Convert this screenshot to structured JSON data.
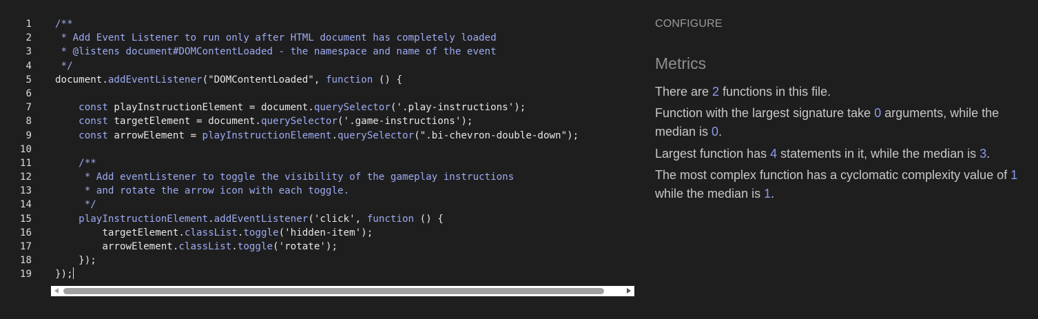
{
  "editor": {
    "lines": [
      {
        "n": "1",
        "tokens": [
          {
            "t": "/**",
            "c": "comment"
          }
        ]
      },
      {
        "n": "2",
        "tokens": [
          {
            "t": " * Add Event Listener to run only after HTML document has completely loaded",
            "c": "comment"
          }
        ]
      },
      {
        "n": "3",
        "tokens": [
          {
            "t": " * @listens document#DOMContentLoaded - the namespace and name of the event",
            "c": "comment"
          }
        ]
      },
      {
        "n": "4",
        "tokens": [
          {
            "t": " */",
            "c": "comment"
          }
        ]
      },
      {
        "n": "5",
        "tokens": [
          {
            "t": "document",
            "c": "plain"
          },
          {
            "t": ".",
            "c": "plain"
          },
          {
            "t": "addEventListener",
            "c": "prop"
          },
          {
            "t": "(\"DOMContentLoaded\", ",
            "c": "string"
          },
          {
            "t": "function",
            "c": "keyword"
          },
          {
            "t": " () {",
            "c": "plain"
          }
        ]
      },
      {
        "n": "6",
        "tokens": []
      },
      {
        "n": "7",
        "tokens": [
          {
            "t": "    const ",
            "c": "keyword"
          },
          {
            "t": "playInstructionElement = document.",
            "c": "plain"
          },
          {
            "t": "querySelector",
            "c": "prop"
          },
          {
            "t": "('.play-instructions');",
            "c": "string"
          }
        ]
      },
      {
        "n": "8",
        "tokens": [
          {
            "t": "    const ",
            "c": "keyword"
          },
          {
            "t": "targetElement = document.",
            "c": "plain"
          },
          {
            "t": "querySelector",
            "c": "prop"
          },
          {
            "t": "('.game-instructions');",
            "c": "string"
          }
        ]
      },
      {
        "n": "9",
        "tokens": [
          {
            "t": "    const ",
            "c": "keyword"
          },
          {
            "t": "arrowElement = ",
            "c": "plain"
          },
          {
            "t": "playInstructionElement",
            "c": "prop"
          },
          {
            "t": ".",
            "c": "plain"
          },
          {
            "t": "querySelector",
            "c": "prop"
          },
          {
            "t": "(\".bi-chevron-double-down\");",
            "c": "string"
          }
        ]
      },
      {
        "n": "10",
        "tokens": []
      },
      {
        "n": "11",
        "tokens": [
          {
            "t": "    /**",
            "c": "comment"
          }
        ]
      },
      {
        "n": "12",
        "tokens": [
          {
            "t": "     * Add eventListener to toggle the visibility of the gameplay instructions",
            "c": "comment"
          }
        ]
      },
      {
        "n": "13",
        "tokens": [
          {
            "t": "     * and rotate the arrow icon with each toggle.",
            "c": "comment"
          }
        ]
      },
      {
        "n": "14",
        "tokens": [
          {
            "t": "     */",
            "c": "comment"
          }
        ]
      },
      {
        "n": "15",
        "tokens": [
          {
            "t": "    playInstructionElement",
            "c": "prop"
          },
          {
            "t": ".",
            "c": "plain"
          },
          {
            "t": "addEventListener",
            "c": "prop"
          },
          {
            "t": "('click', ",
            "c": "string"
          },
          {
            "t": "function",
            "c": "keyword"
          },
          {
            "t": " () {",
            "c": "plain"
          }
        ]
      },
      {
        "n": "16",
        "tokens": [
          {
            "t": "        targetElement.",
            "c": "plain"
          },
          {
            "t": "classList",
            "c": "prop"
          },
          {
            "t": ".",
            "c": "plain"
          },
          {
            "t": "toggle",
            "c": "prop"
          },
          {
            "t": "('hidden-item');",
            "c": "string"
          }
        ]
      },
      {
        "n": "17",
        "tokens": [
          {
            "t": "        arrowElement.",
            "c": "plain"
          },
          {
            "t": "classList",
            "c": "prop"
          },
          {
            "t": ".",
            "c": "plain"
          },
          {
            "t": "toggle",
            "c": "prop"
          },
          {
            "t": "('rotate');",
            "c": "string"
          }
        ]
      },
      {
        "n": "18",
        "tokens": [
          {
            "t": "    });",
            "c": "plain"
          }
        ]
      },
      {
        "n": "19",
        "tokens": [
          {
            "t": "});",
            "c": "plain"
          }
        ],
        "caret": true
      }
    ]
  },
  "panel": {
    "configure_label": "CONFIGURE",
    "metrics_title": "Metrics",
    "metrics": [
      {
        "segments": [
          {
            "t": "There are "
          },
          {
            "t": "2",
            "num": true
          },
          {
            "t": " functions in this file."
          }
        ]
      },
      {
        "segments": [
          {
            "t": "Function with the largest signature take "
          },
          {
            "t": "0",
            "num": true
          },
          {
            "t": " arguments, while the median is "
          },
          {
            "t": "0",
            "num": true
          },
          {
            "t": "."
          }
        ]
      },
      {
        "segments": [
          {
            "t": "Largest function has "
          },
          {
            "t": "4",
            "num": true
          },
          {
            "t": " statements in it, while the median is "
          },
          {
            "t": "3",
            "num": true
          },
          {
            "t": "."
          }
        ]
      },
      {
        "segments": [
          {
            "t": "The most complex function has a cyclomatic complexity value of "
          },
          {
            "t": "1",
            "num": true
          },
          {
            "t": " while the median is "
          },
          {
            "t": "1",
            "num": true
          },
          {
            "t": "."
          }
        ]
      }
    ]
  },
  "colors": {
    "background": "#1e1e1e",
    "accent_number": "#8a9bf0",
    "code_highlight": "#9dabf2"
  }
}
